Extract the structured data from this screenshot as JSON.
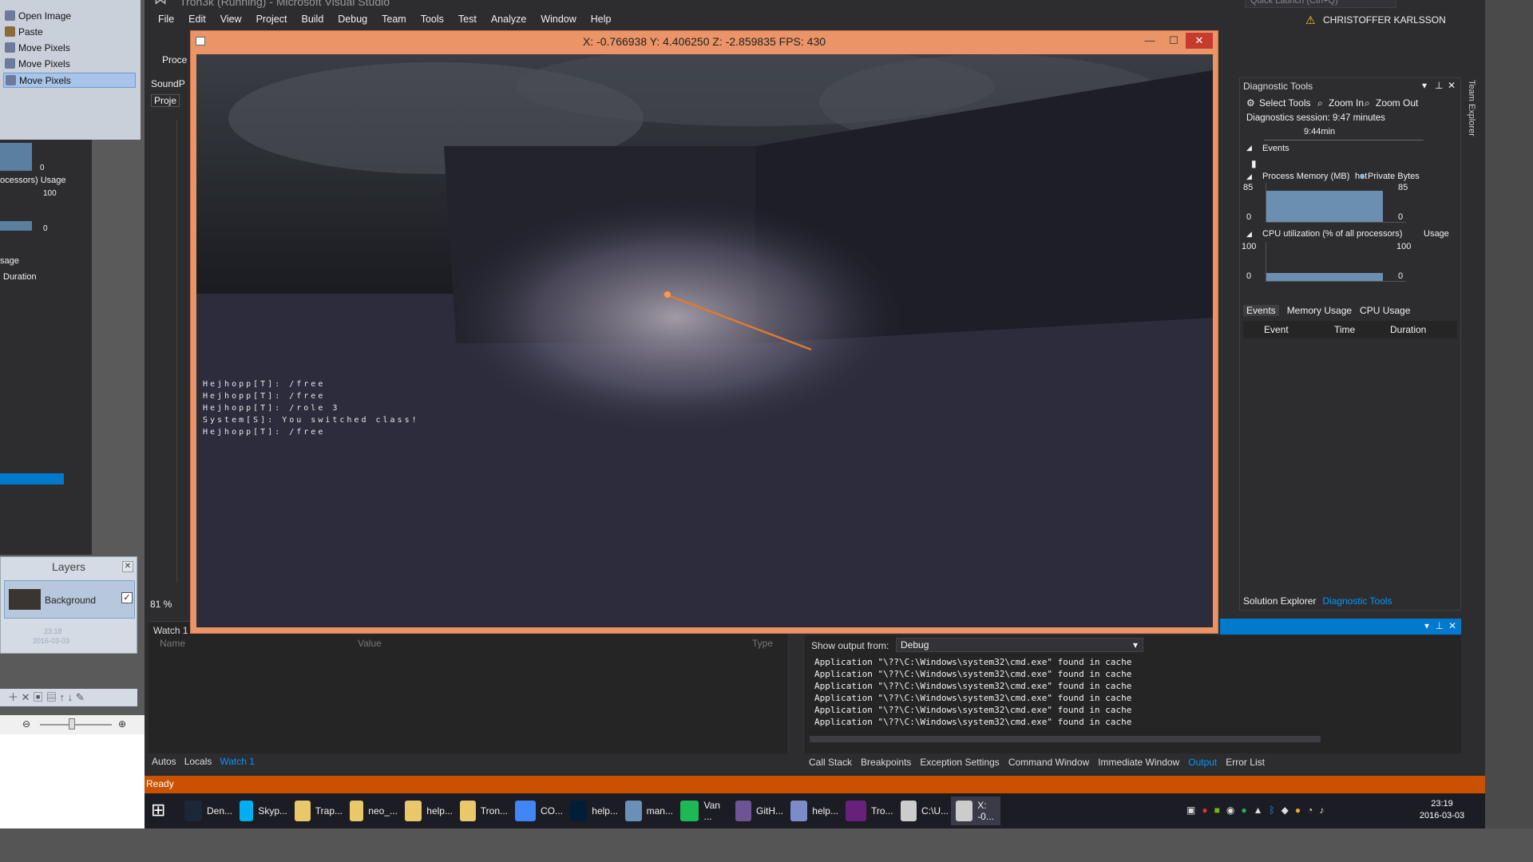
{
  "vs": {
    "title": "Tron3k (Running) - Microsoft Visual Studio",
    "quick_launch": "Quick Launch (Ctrl+Q)",
    "user": "CHRISTOFFER KARLSSON",
    "menu": [
      "File",
      "Edit",
      "View",
      "Project",
      "Build",
      "Debug",
      "Team",
      "Tools",
      "Test",
      "Analyze",
      "Window",
      "Help"
    ]
  },
  "game": {
    "title": "X: -0.766938  Y: 4.406250  Z: -2.859835  FPS: 430",
    "chat": [
      "Hejhopp[T]: /free",
      "Hejhopp[T]: /free",
      "Hejhopp[T]: /role 3",
      "System[S]: You switched class!",
      "Hejhopp[T]: /free"
    ]
  },
  "history": {
    "items": [
      "Open Image",
      "Paste",
      "Move Pixels",
      "Move Pixels",
      "Move Pixels"
    ]
  },
  "layers": {
    "title": "Layers",
    "layer_name": "Background"
  },
  "left_labels": {
    "cpu_usage": "ocessors) Usage",
    "usage": "sage",
    "duration": "Duration",
    "val_100": "100",
    "val_0a": "0",
    "val_0b": "0"
  },
  "editor": {
    "zoom_pct": "81 %",
    "proc_label": "Proce",
    "sound_label": "SoundP",
    "proj_label": "Proje"
  },
  "watch": {
    "title": "Watch 1",
    "columns": [
      "Name",
      "Value",
      "Type"
    ],
    "tabs": [
      "Autos",
      "Locals",
      "Watch 1"
    ]
  },
  "output": {
    "show_from_label": "Show output from:",
    "source": "Debug",
    "lines": [
      "Application \"\\??\\C:\\Windows\\system32\\cmd.exe\" found in cache",
      "Application \"\\??\\C:\\Windows\\system32\\cmd.exe\" found in cache",
      "Application \"\\??\\C:\\Windows\\system32\\cmd.exe\" found in cache",
      "Application \"\\??\\C:\\Windows\\system32\\cmd.exe\" found in cache",
      "Application \"\\??\\C:\\Windows\\system32\\cmd.exe\" found in cache",
      "Application \"\\??\\C:\\Windows\\system32\\cmd.exe\" found in cache"
    ]
  },
  "bottom_tabs": [
    "Call Stack",
    "Breakpoints",
    "Exception Settings",
    "Command Window",
    "Immediate Window",
    "Output",
    "Error List"
  ],
  "diag": {
    "title": "Diagnostic Tools",
    "select_tools": "Select Tools",
    "zoom_in": "Zoom In",
    "zoom_out": "Zoom Out",
    "session": "Diagnostics session: 9:47 minutes",
    "timeline": "9:44min",
    "events_header": "Events",
    "memory_header": "Process Memory (MB)",
    "memory_legend_hot": "hot",
    "memory_legend_private": "Private Bytes",
    "mem_max": "85",
    "mem_min": "0",
    "memory_level": 0.8,
    "cpu_header": "CPU utilization (% of all processors)",
    "cpu_usage_label": "Usage",
    "cpu_max": "100",
    "cpu_min": "0",
    "tabs": [
      "Events",
      "Memory Usage",
      "CPU Usage"
    ],
    "columns": [
      "Event",
      "Time",
      "Duration"
    ],
    "footer_tabs": [
      "Solution Explorer",
      "Diagnostic Tools"
    ],
    "team_explorer": "Team Explorer"
  },
  "status": "Ready",
  "taskbar": [
    {
      "label": "Den...",
      "color": "#1b2838"
    },
    {
      "label": "Skyp...",
      "color": "#00aff0"
    },
    {
      "label": "Trap...",
      "color": "#e8c86a"
    },
    {
      "label": "neo_...",
      "color": "#e8c86a"
    },
    {
      "label": "help...",
      "color": "#e8c86a"
    },
    {
      "label": "Tron...",
      "color": "#e8c86a"
    },
    {
      "label": "CO...",
      "color": "#4285f4"
    },
    {
      "label": "help...",
      "color": "#001e36"
    },
    {
      "label": "man...",
      "color": "#6a8fb8"
    },
    {
      "label": "Van ...",
      "color": "#1db954"
    },
    {
      "label": "GitH...",
      "color": "#6e5494"
    },
    {
      "label": "help...",
      "color": "#7b8cc8"
    },
    {
      "label": "Tro...",
      "color": "#68217a"
    },
    {
      "label": "C:\\U...",
      "color": "#cccccc"
    },
    {
      "label": "X: -0...",
      "color": "#cccccc"
    }
  ],
  "clock": {
    "time": "23:19",
    "date": "2016-03-03"
  },
  "layer_date": {
    "time": "23:18",
    "date": "2016-03-03"
  },
  "colors": {
    "accent": "#007acc",
    "status": "#ca5100",
    "game_frame": "#ea9468"
  }
}
